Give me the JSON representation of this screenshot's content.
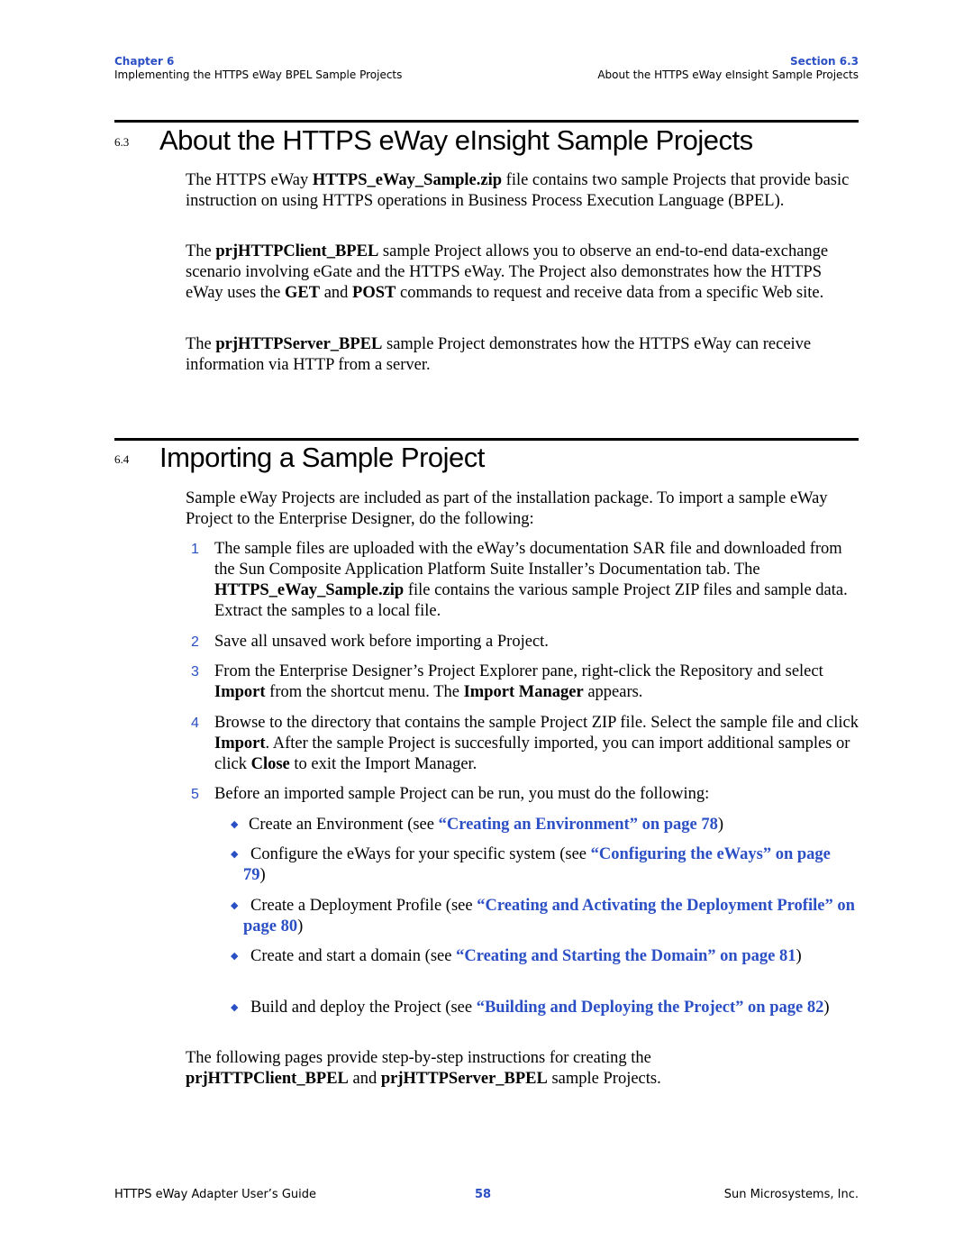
{
  "header": {
    "chapter_label": "Chapter 6",
    "chapter_title": "Implementing the HTTPS eWay BPEL Sample Projects",
    "section_label": "Section 6.3",
    "section_title": "About the HTTPS eWay eInsight Sample Projects"
  },
  "section_63": {
    "number": "6.3",
    "title": "About the HTTPS eWay eInsight Sample Projects",
    "p1": {
      "a": "The HTTPS eWay ",
      "b": "HTTPS_eWay_Sample.zip",
      "c": " file contains two sample Projects that provide basic instruction on using HTTPS operations in Business Process Execution Language (BPEL)."
    },
    "p2": {
      "a": "The ",
      "b": "prjHTTPClient_BPEL",
      "c": " sample Project allows you to observe an end-to-end data-exchange scenario involving eGate and the HTTPS eWay. The Project also demonstrates how the HTTPS eWay uses the ",
      "d": "GET",
      "e": " and ",
      "f": "POST",
      "g": " commands to request and receive data from a specific Web site."
    },
    "p3": {
      "a": "The ",
      "b": "prjHTTPServer_BPEL",
      "c": " sample Project demonstrates how the HTTPS eWay can receive information via HTTP from a server."
    }
  },
  "section_64": {
    "number": "6.4",
    "title": "Importing a Sample Project",
    "intro": "Sample eWay Projects are included as part of the installation package. To import a sample eWay Project to the Enterprise Designer, do the following:",
    "steps": [
      {
        "num": "1",
        "a": "The sample files are uploaded with the eWay’s documentation SAR file and downloaded from the Sun Composite Application Platform Suite Installer’s Documentation tab. The ",
        "b": "HTTPS_eWay_Sample.zip",
        "c": " file contains the various sample Project ZIP files and sample data. Extract the samples to a local file."
      },
      {
        "num": "2",
        "a": "Save all unsaved work before importing a Project."
      },
      {
        "num": "3",
        "a": "From the Enterprise Designer’s Project Explorer pane, right-click the Repository and select ",
        "b": "Import",
        "c": " from the shortcut menu. The ",
        "d": "Import Manager",
        "e": " appears."
      },
      {
        "num": "4",
        "a": "Browse to the directory that contains the sample Project ZIP file. Select the sample file and click ",
        "b": "Import",
        "c": ". After the sample Project is succesfully imported, you can import additional samples or click ",
        "d": "Close",
        "e": " to exit the Import Manager."
      },
      {
        "num": "5",
        "a": "Before an imported sample Project can be run, you must do the following:"
      }
    ],
    "bullets": [
      {
        "text": "Create an Environment (see ",
        "link": "“Creating an Environment” on page 78",
        "end": ")"
      },
      {
        "text": "Configure the eWays for your specific system (see ",
        "link": "“Configuring the eWays” on page 79",
        "end": ")"
      },
      {
        "text": "Create a Deployment Profile (see ",
        "link": "“Creating and Activating the Deployment Profile” on page 80",
        "end": ")"
      },
      {
        "text": "Create and start a domain (see ",
        "link": "“Creating and Starting the Domain” on page 81",
        "end": ")"
      },
      {
        "text": "Build and deploy the Project (see ",
        "link": "“Building and Deploying the Project” on page 82",
        "end": ")"
      }
    ],
    "closing": {
      "a": "The following pages provide step-by-step instructions for creating the ",
      "b": "prjHTTPClient_BPEL",
      "c": " and ",
      "d": "prjHTTPServer_BPEL",
      "e": " sample Projects."
    }
  },
  "footer": {
    "guide_title": "HTTPS eWay Adapter User’s Guide",
    "page_number": "58",
    "company": "Sun Microsystems, Inc."
  },
  "icons": {
    "bullet": "diamond-bullet-icon"
  }
}
